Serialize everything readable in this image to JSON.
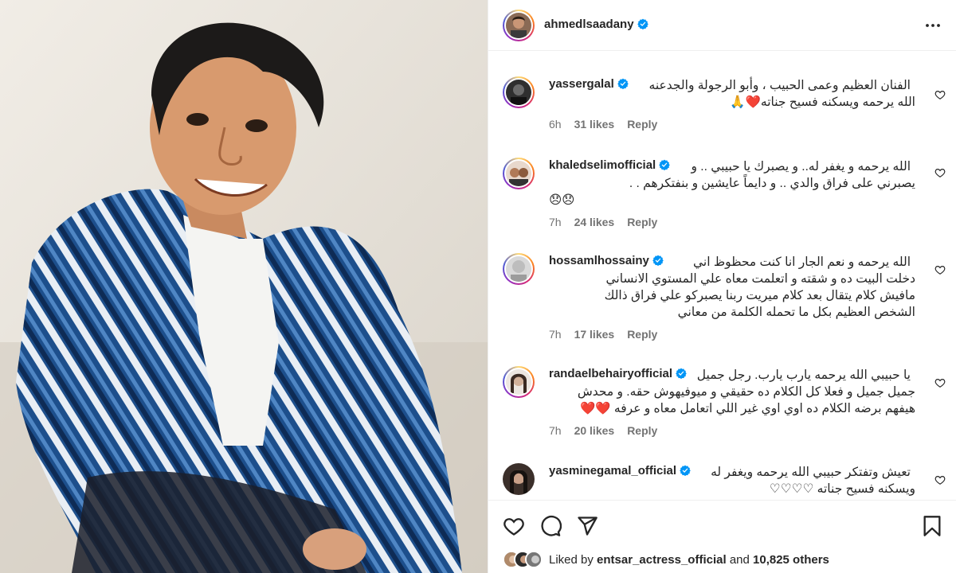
{
  "post": {
    "author": {
      "username": "ahmedlsaadany",
      "verified": true
    },
    "more_icon": "more-horizontal-icon"
  },
  "comments": [
    {
      "username": "yassergalal",
      "line1": "الفنان العظيم وعمى الحبيب ، وأبو الرجولة والجدعنه",
      "rest": [
        "الله يرحمه ويسكنه فسيح جناته❤️🙏"
      ],
      "time": "6h",
      "likes": "31 likes",
      "reply": "Reply"
    },
    {
      "username": "khaledselimofficial",
      "line1": "الله يرحمه و يغفر له.. و يصبرك يا حبيبي .. و",
      "rest": [
        "يصبرني على فراق والدي .. و دايماً عايشين و بنفتكرهم . .",
        "😞😞"
      ],
      "time": "7h",
      "likes": "24 likes",
      "reply": "Reply"
    },
    {
      "username": "hossamlhossainy",
      "line1": "الله يرحمه و نعم الجار انا كنت محظوظ اني",
      "rest": [
        "دخلت البيت ده و شقته و اتعلمت معاه علي المستوي الانساني",
        "مافيش كلام يتقال بعد كلام ميريت ربنا يصبركو علي فراق ذالك",
        "الشخص العظيم بكل ما تحمله الكلمة من معاني"
      ],
      "time": "7h",
      "likes": "17 likes",
      "reply": "Reply"
    },
    {
      "username": "randaelbehairyofficial",
      "line1": "يا حبيبي الله يرحمه يارب يارب. رجل جميل",
      "rest": [
        "جميل جميل و فعلا كل الكلام ده حقيقي و ميوفيهوش حقه. و محدش",
        "هيفهم برضه الكلام ده اوي اوي غير اللي اتعامل معاه و عرفه ❤️❤️"
      ],
      "time": "7h",
      "likes": "20 likes",
      "reply": "Reply"
    },
    {
      "username": "yasminegamal_official",
      "line1": "تعيش وتفتكر حبيبي الله يرحمه ويغفر له",
      "rest": [
        "ويسكنه فسيح جناته ♡♡♡♡"
      ],
      "time": "",
      "likes": "",
      "reply": ""
    }
  ],
  "actions": {
    "like_icon": "heart-icon",
    "comment_icon": "comment-icon",
    "share_icon": "share-icon",
    "save_icon": "bookmark-icon"
  },
  "likes_summary": {
    "prefix": "Liked by",
    "user": "entsar_actress_official",
    "middle": "and",
    "others": "10,825 others"
  },
  "colors": {
    "verified": "#0095f6",
    "text": "#262626",
    "secondary": "#737373",
    "divider": "#efefef"
  }
}
